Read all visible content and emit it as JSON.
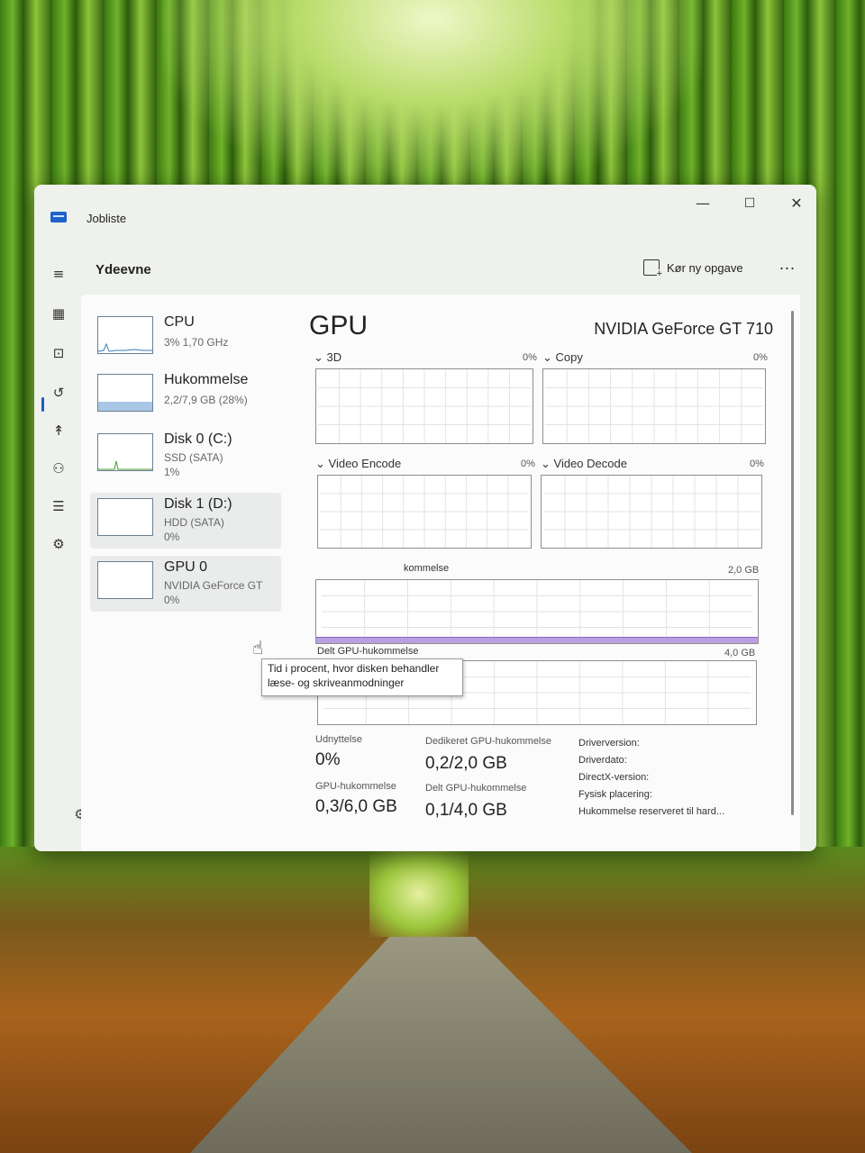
{
  "window": {
    "title": "Jobliste",
    "minimize": "—",
    "maximize": "☐",
    "close": "✕"
  },
  "header": {
    "page_title": "Ydeevne",
    "run_task_label": "Kør ny opgave",
    "more": "..."
  },
  "nav": {
    "items": [
      "menu-icon",
      "processes-icon",
      "performance-icon",
      "history-icon",
      "startup-icon",
      "users-icon",
      "details-icon",
      "services-icon"
    ],
    "settings": "settings-icon"
  },
  "devices": [
    {
      "name": "CPU",
      "sub1": "3% 1,70 GHz",
      "sub2": ""
    },
    {
      "name": "Hukommelse",
      "sub1": "2,2/7,9 GB (28%)",
      "sub2": ""
    },
    {
      "name": "Disk 0 (C:)",
      "sub1": "SSD (SATA)",
      "sub2": "1%"
    },
    {
      "name": "Disk 1 (D:)",
      "sub1": "HDD (SATA)",
      "sub2": "0%"
    },
    {
      "name": "GPU 0",
      "sub1": "NVIDIA GeForce GT",
      "sub2": "0%"
    }
  ],
  "gpu": {
    "title": "GPU",
    "model": "NVIDIA GeForce GT 710",
    "engines": [
      {
        "label": "3D",
        "pct": "0%"
      },
      {
        "label": "Copy",
        "pct": "0%"
      },
      {
        "label": "Video Encode",
        "pct": "0%"
      },
      {
        "label": "Video Decode",
        "pct": "0%"
      }
    ],
    "dedicated_chart": {
      "label": "kommelse",
      "max": "2,0 GB"
    },
    "shared_chart": {
      "label": "Delt GPU-hukommelse",
      "max": "4,0 GB"
    },
    "stats": {
      "utilization_label": "Udnyttelse",
      "utilization": "0%",
      "dedicated_label": "Dedikeret GPU-hukommelse",
      "dedicated": "0,2/2,0 GB",
      "gpu_mem_label": "GPU-hukommelse",
      "gpu_mem": "0,3/6,0 GB",
      "shared_label": "Delt GPU-hukommelse",
      "shared": "0,1/4,0 GB"
    },
    "info": [
      "Driverversion:",
      "Driverdato:",
      "DirectX-version:",
      "Fysisk placering:",
      "Hukommelse reserveret til hard..."
    ]
  },
  "tooltip": {
    "line1": "Tid i procent, hvor disken behandler",
    "line2": "læse- og skriveanmodninger"
  },
  "colors": {
    "accent": "#1a5fc4",
    "memory_fill": "#b9a0e0",
    "disk_green": "#4a9a2a"
  }
}
